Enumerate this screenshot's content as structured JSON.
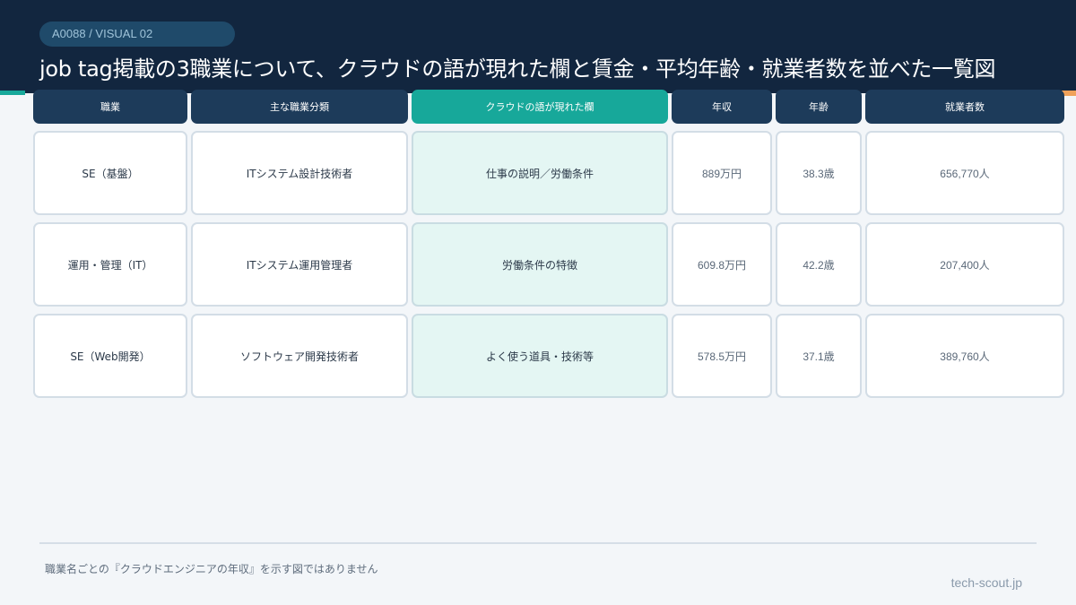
{
  "header": {
    "tag": "A0088 / VISUAL 02",
    "title": "job tag掲載の3職業について、クラウドの語が現れた欄と賃金・平均年齢・就業者数を並べた一覧図"
  },
  "table": {
    "columns": [
      "職業",
      "主な職業分類",
      "クラウドの語が現れた欄",
      "年収",
      "年齢",
      "就業者数"
    ],
    "rows": [
      [
        "SE（基盤）",
        "ITシステム設計技術者",
        "仕事の説明／労働条件",
        "889万円",
        "38.3歳",
        "656,770人"
      ],
      [
        "運用・管理（IT）",
        "ITシステム運用管理者",
        "労働条件の特徴",
        "609.8万円",
        "42.2歳",
        "207,400人"
      ],
      [
        "SE（Web開発）",
        "ソフトウェア開発技術者",
        "よく使う道具・技術等",
        "578.5万円",
        "37.1歳",
        "389,760人"
      ]
    ]
  },
  "footer": {
    "note": "職業名ごとの『クラウドエンジニアの年収』を示す図ではありません",
    "site": "tech-scout.jp"
  },
  "colors": {
    "header_bg": "#12263f",
    "accent_teal": "#17a89a",
    "accent_orange": "#f0a25a"
  }
}
